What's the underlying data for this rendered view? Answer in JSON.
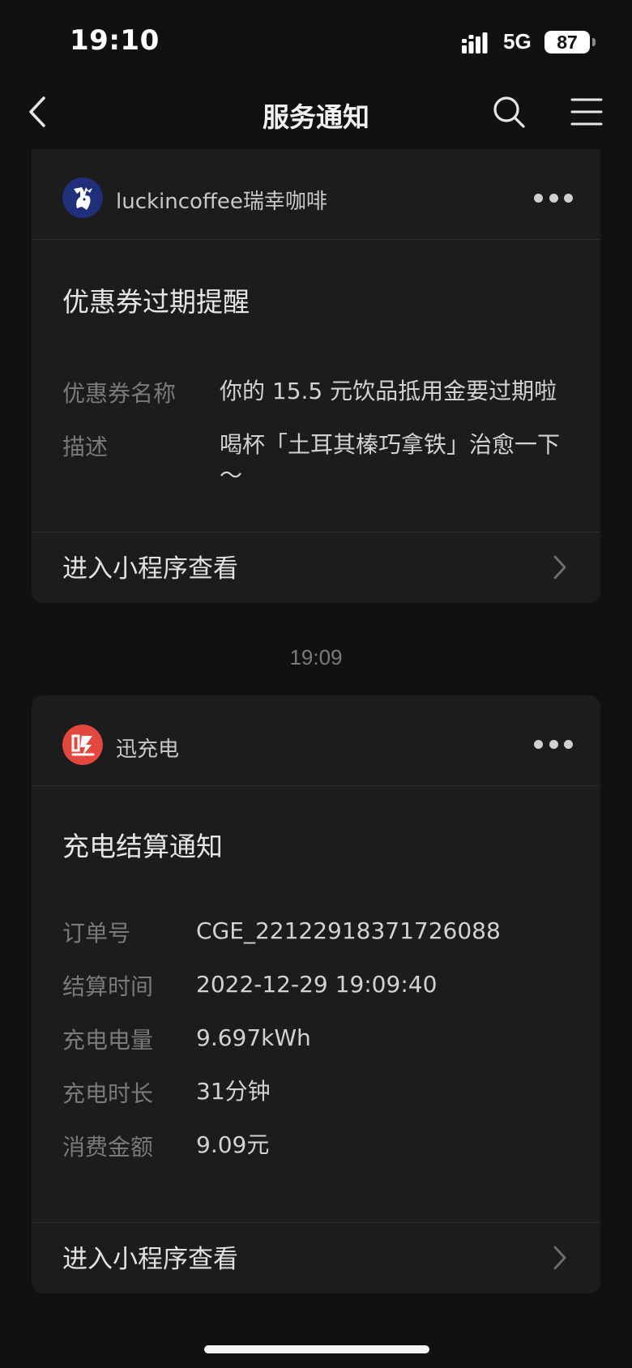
{
  "status_bar": {
    "time": "19:10",
    "network": "5G",
    "battery": "87"
  },
  "nav": {
    "title": "服务通知",
    "icons": [
      "back-chevron-icon",
      "search-icon",
      "menu-icon"
    ]
  },
  "notifications": [
    {
      "source": "luckincoffee瑞幸咖啡",
      "avatar_icon": "luckin-deer-logo-icon",
      "title": "优惠券过期提醒",
      "fields": [
        {
          "label": "优惠券名称",
          "value": "你的 15.5 元饮品抵用金要过期啦"
        },
        {
          "label": "描述",
          "value": "喝杯「土耳其榛巧拿铁」治愈一下～"
        }
      ],
      "action": "进入小程序查看"
    },
    {
      "time_label": "19:09",
      "source": "迅充电",
      "avatar_icon": "xun-charging-logo-icon",
      "title": "充电结算通知",
      "fields": [
        {
          "label": "订单号",
          "value": "CGE_22122918371726088"
        },
        {
          "label": "结算时间",
          "value": "2022-12-29 19:09:40"
        },
        {
          "label": "充电电量",
          "value": "9.697kWh"
        },
        {
          "label": "充电时长",
          "value": "31分钟"
        },
        {
          "label": "消费金额",
          "value": "9.09元"
        }
      ],
      "action": "进入小程序查看"
    }
  ],
  "colors": {
    "background": "#111111",
    "card": "#1c1c1c",
    "luckin_blue": "#1f2f7a",
    "xun_red": "#e2483d"
  }
}
